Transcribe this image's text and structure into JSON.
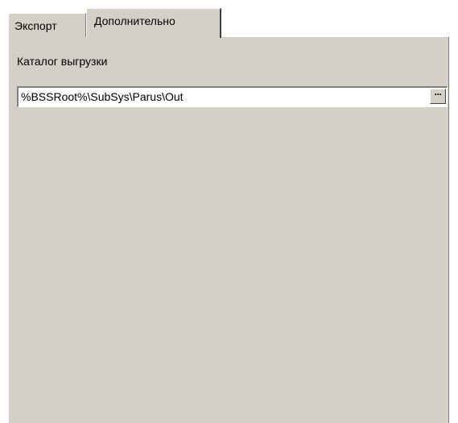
{
  "tabs": [
    {
      "label": "Экспорт",
      "active": false
    },
    {
      "label": "Дополнительно",
      "active": true
    }
  ],
  "export_folder": {
    "label": "Каталог выгрузки",
    "value": "%BSSRoot%\\SubSys\\Parus\\Out",
    "browse_label": "···"
  },
  "colors": {
    "panel": "#d4d0c8",
    "field": "#ffffff",
    "shadow": "#808080",
    "highlight": "#ffffff"
  }
}
